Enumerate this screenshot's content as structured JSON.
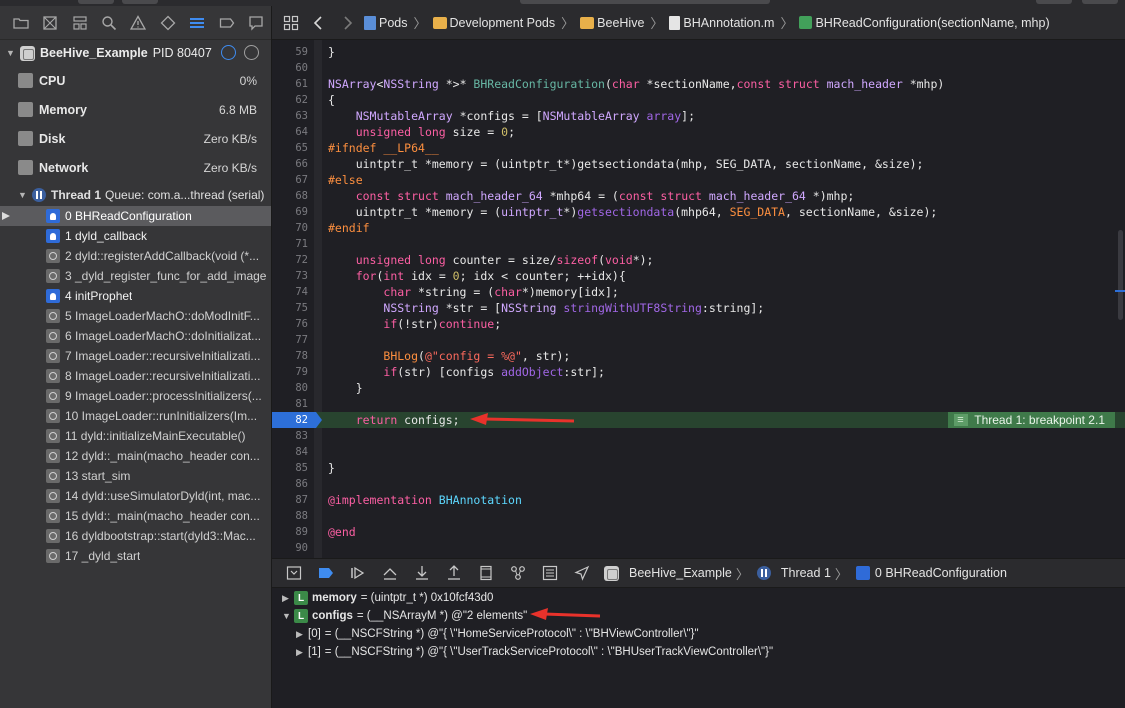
{
  "breadcrumbs": [
    "Pods",
    "Development Pods",
    "BeeHive",
    "BHAnnotation.m",
    "BHReadConfiguration(sectionName, mhp)"
  ],
  "process": {
    "name": "BeeHive_Example",
    "pid": "PID 80407"
  },
  "gauges": [
    {
      "name": "CPU",
      "value": "0%"
    },
    {
      "name": "Memory",
      "value": "6.8 MB"
    },
    {
      "name": "Disk",
      "value": "Zero KB/s"
    },
    {
      "name": "Network",
      "value": "Zero KB/s"
    }
  ],
  "thread": {
    "label": "Thread 1",
    "queue": "Queue: com.a...thread (serial)"
  },
  "frames": [
    {
      "text": "0 BHReadConfiguration",
      "kind": "user",
      "selected": true
    },
    {
      "text": "1 dyld_callback",
      "kind": "user"
    },
    {
      "text": "2 dyld::registerAddCallback(void (*...",
      "kind": "sys"
    },
    {
      "text": "3 _dyld_register_func_for_add_image",
      "kind": "sys"
    },
    {
      "text": "4 initProphet",
      "kind": "user"
    },
    {
      "text": "5 ImageLoaderMachO::doModInitF...",
      "kind": "sys"
    },
    {
      "text": "6 ImageLoaderMachO::doInitializat...",
      "kind": "sys"
    },
    {
      "text": "7 ImageLoader::recursiveInitializati...",
      "kind": "sys"
    },
    {
      "text": "8 ImageLoader::recursiveInitializati...",
      "kind": "sys"
    },
    {
      "text": "9 ImageLoader::processInitializers(...",
      "kind": "sys"
    },
    {
      "text": "10 ImageLoader::runInitializers(Im...",
      "kind": "sys"
    },
    {
      "text": "11 dyld::initializeMainExecutable()",
      "kind": "sys"
    },
    {
      "text": "12 dyld::_main(macho_header con...",
      "kind": "sys"
    },
    {
      "text": "13 start_sim",
      "kind": "sys"
    },
    {
      "text": "14 dyld::useSimulatorDyld(int, mac...",
      "kind": "sys"
    },
    {
      "text": "15 dyld::_main(macho_header con...",
      "kind": "sys"
    },
    {
      "text": "16 dyldbootstrap::start(dyld3::Mac...",
      "kind": "sys"
    },
    {
      "text": "17 _dyld_start",
      "kind": "sys"
    }
  ],
  "code_lines": [
    {
      "n": "59",
      "t": [
        [
          "}",
          ""
        ]
      ]
    },
    {
      "n": "60",
      "t": []
    },
    {
      "n": "61",
      "t": [
        [
          "NSArray",
          "ty"
        ],
        [
          "<",
          ""
        ],
        [
          "NSString",
          "ty"
        ],
        [
          " *>* ",
          ""
        ],
        [
          "BHReadConfiguration",
          "fn"
        ],
        [
          "(",
          ""
        ],
        [
          "char",
          "kw"
        ],
        [
          " *sectionName,",
          ""
        ],
        [
          "const",
          "kw"
        ],
        [
          " ",
          ""
        ],
        [
          "struct",
          "kw"
        ],
        [
          " ",
          ""
        ],
        [
          "mach_header",
          "ty"
        ],
        [
          " *mhp)",
          ""
        ]
      ]
    },
    {
      "n": "62",
      "t": [
        [
          "{",
          ""
        ]
      ]
    },
    {
      "n": "63",
      "t": [
        [
          "    ",
          ""
        ],
        [
          "NSMutableArray",
          "ty"
        ],
        [
          " *configs = [",
          ""
        ],
        [
          "NSMutableArray",
          "ty"
        ],
        [
          " ",
          ""
        ],
        [
          "array",
          "mt"
        ],
        [
          "];",
          ""
        ]
      ]
    },
    {
      "n": "64",
      "t": [
        [
          "    ",
          ""
        ],
        [
          "unsigned",
          "kw"
        ],
        [
          " ",
          ""
        ],
        [
          "long",
          "kw"
        ],
        [
          " size = ",
          ""
        ],
        [
          "0",
          "num"
        ],
        [
          ";",
          ""
        ]
      ]
    },
    {
      "n": "65",
      "t": [
        [
          "#ifndef __LP64__",
          "pp"
        ]
      ]
    },
    {
      "n": "66",
      "t": [
        [
          "    uintptr_t *memory = (uintptr_t*)getsectiondata(mhp, SEG_DATA, sectionName, &size);",
          ""
        ]
      ]
    },
    {
      "n": "67",
      "t": [
        [
          "#else",
          "pp"
        ]
      ]
    },
    {
      "n": "68",
      "t": [
        [
          "    ",
          ""
        ],
        [
          "const",
          "kw"
        ],
        [
          " ",
          ""
        ],
        [
          "struct",
          "kw"
        ],
        [
          " ",
          ""
        ],
        [
          "mach_header_64",
          "ty"
        ],
        [
          " *mhp64 = (",
          ""
        ],
        [
          "const",
          "kw"
        ],
        [
          " ",
          ""
        ],
        [
          "struct",
          "kw"
        ],
        [
          " ",
          ""
        ],
        [
          "mach_header_64",
          "ty"
        ],
        [
          " *)mhp;",
          ""
        ]
      ]
    },
    {
      "n": "69",
      "t": [
        [
          "    uintptr_t *memory = (",
          ""
        ],
        [
          "uintptr_t",
          "ty"
        ],
        [
          "*)",
          ""
        ],
        [
          "getsectiondata",
          "mt"
        ],
        [
          "(mhp64, ",
          ""
        ],
        [
          "SEG_DATA",
          "pp"
        ],
        [
          ", sectionName, &size);",
          ""
        ]
      ]
    },
    {
      "n": "70",
      "t": [
        [
          "#endif",
          "pp"
        ]
      ]
    },
    {
      "n": "71",
      "t": []
    },
    {
      "n": "72",
      "t": [
        [
          "    ",
          ""
        ],
        [
          "unsigned",
          "kw"
        ],
        [
          " ",
          ""
        ],
        [
          "long",
          "kw"
        ],
        [
          " counter = size/",
          ""
        ],
        [
          "sizeof",
          "kw"
        ],
        [
          "(",
          ""
        ],
        [
          "void",
          "kw"
        ],
        [
          "*);",
          ""
        ]
      ]
    },
    {
      "n": "73",
      "t": [
        [
          "    ",
          ""
        ],
        [
          "for",
          "kw"
        ],
        [
          "(",
          ""
        ],
        [
          "int",
          "kw"
        ],
        [
          " idx = ",
          ""
        ],
        [
          "0",
          "num"
        ],
        [
          "; idx < counter; ++idx){",
          ""
        ]
      ]
    },
    {
      "n": "74",
      "t": [
        [
          "        ",
          ""
        ],
        [
          "char",
          "kw"
        ],
        [
          " *string = (",
          ""
        ],
        [
          "char",
          "kw"
        ],
        [
          "*)memory[idx];",
          ""
        ]
      ]
    },
    {
      "n": "75",
      "t": [
        [
          "        ",
          ""
        ],
        [
          "NSString",
          "ty"
        ],
        [
          " *str = [",
          ""
        ],
        [
          "NSString",
          "ty"
        ],
        [
          " ",
          ""
        ],
        [
          "stringWithUTF8String",
          "mt"
        ],
        [
          ":string];",
          ""
        ]
      ]
    },
    {
      "n": "76",
      "t": [
        [
          "        ",
          ""
        ],
        [
          "if",
          "kw"
        ],
        [
          "(!str)",
          ""
        ],
        [
          "continue",
          "kw"
        ],
        [
          ";",
          ""
        ]
      ]
    },
    {
      "n": "77",
      "t": []
    },
    {
      "n": "78",
      "t": [
        [
          "        ",
          ""
        ],
        [
          "BHLog",
          "pp"
        ],
        [
          "(",
          ""
        ],
        [
          "@\"config = %@\"",
          "str"
        ],
        [
          ", str);",
          ""
        ]
      ]
    },
    {
      "n": "79",
      "t": [
        [
          "        ",
          ""
        ],
        [
          "if",
          "kw"
        ],
        [
          "(str) [configs ",
          ""
        ],
        [
          "addObject",
          "mt"
        ],
        [
          ":str];",
          ""
        ]
      ]
    },
    {
      "n": "80",
      "t": [
        [
          "    }",
          ""
        ]
      ]
    },
    {
      "n": "81",
      "t": []
    },
    {
      "n": "82",
      "t": [
        [
          "    ",
          ""
        ],
        [
          "return",
          "kw"
        ],
        [
          " configs;",
          ""
        ]
      ],
      "breakpoint": true
    },
    {
      "n": "83",
      "t": []
    },
    {
      "n": "84",
      "t": []
    },
    {
      "n": "85",
      "t": [
        [
          "}",
          ""
        ]
      ]
    },
    {
      "n": "86",
      "t": []
    },
    {
      "n": "87",
      "t": [
        [
          "@implementation",
          "kw"
        ],
        [
          " ",
          ""
        ],
        [
          "BHAnnotation",
          "cls"
        ]
      ]
    },
    {
      "n": "88",
      "t": []
    },
    {
      "n": "89",
      "t": [
        [
          "@end",
          "kw"
        ]
      ]
    },
    {
      "n": "90",
      "t": []
    }
  ],
  "breakpoint_label": "Thread 1: breakpoint 2.1",
  "debug_breadcrumbs": [
    "BeeHive_Example",
    "Thread 1",
    "0 BHReadConfiguration"
  ],
  "variables": [
    {
      "name": "memory",
      "value": "= (uintptr_t *) 0x10fcf43d0",
      "badge": "L",
      "expanded": false,
      "indent": 0
    },
    {
      "name": "configs",
      "value": "= (__NSArrayM *) @\"2 elements\"",
      "badge": "L",
      "expanded": true,
      "indent": 0
    },
    {
      "name": "[0]",
      "value": "= (__NSCFString *) @\"{ \\\"HomeServiceProtocol\\\" : \\\"BHViewController\\\"}\"",
      "badge": "",
      "expanded": false,
      "indent": 1
    },
    {
      "name": "[1]",
      "value": "= (__NSCFString *) @\"{ \\\"UserTrackServiceProtocol\\\" : \\\"BHUserTrackViewController\\\"}\"",
      "badge": "",
      "expanded": false,
      "indent": 1
    }
  ],
  "colors": {
    "accent": "#2d6fd8",
    "breakpoint_line": "#28442f",
    "annotation_arrow": "#e8322b"
  }
}
